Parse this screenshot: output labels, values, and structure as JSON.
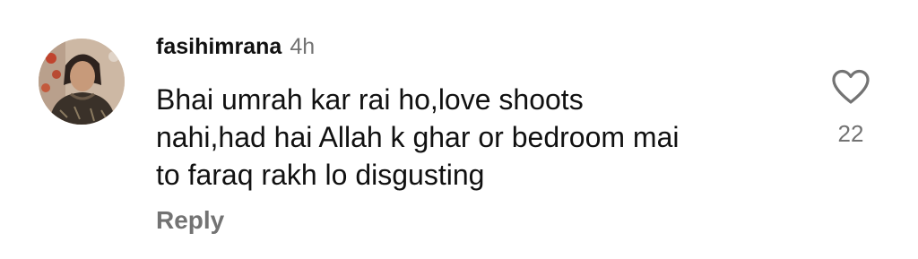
{
  "comment": {
    "username": "fasihimrana",
    "timestamp": "4h",
    "lines": [
      "Bhai umrah kar rai ho,love shoots",
      "nahi,had hai Allah k ghar or bedroom mai",
      "to faraq rakh lo disgusting"
    ],
    "reply_label": "Reply",
    "like_icon": "heart-outline-icon",
    "like_count": "22"
  },
  "colors": {
    "text_primary": "#111111",
    "text_secondary": "#737373",
    "background": "#ffffff"
  }
}
